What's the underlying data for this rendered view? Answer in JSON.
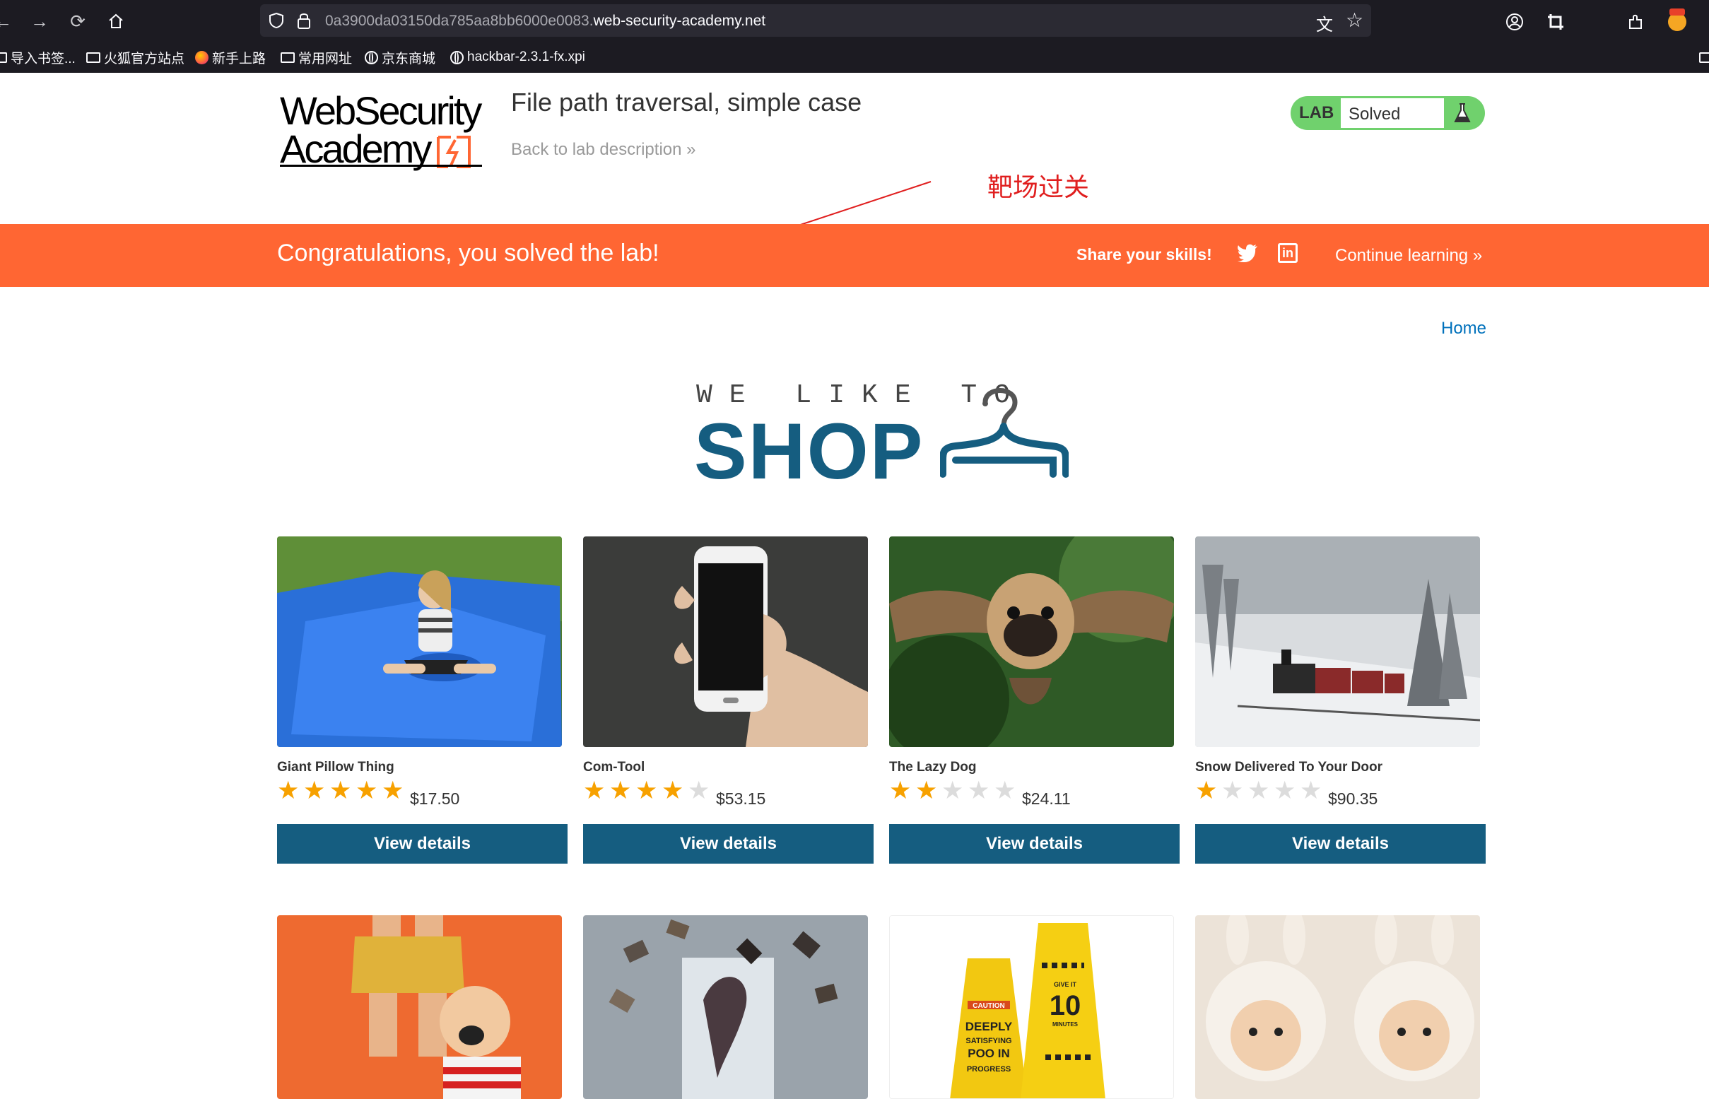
{
  "browser": {
    "url_prefix": "0a3900da03150da785aa8bb6000e0083.",
    "url_domain": "web-security-academy.net",
    "bookmarks": [
      "导入书签...",
      "火狐官方站点",
      "新手上路",
      "常用网址",
      "京东商城",
      "hackbar-2.3.1-fx.xpi"
    ]
  },
  "header": {
    "logo_line1": "WebSecurity",
    "logo_line2": "Academy",
    "lab_title": "File path traversal, simple case",
    "back_link": "Back to lab description",
    "back_chevron": "»",
    "lab_label": "LAB",
    "lab_status": "Solved"
  },
  "annotation": "靶场过关",
  "banner": {
    "message": "Congratulations, you solved the lab!",
    "share": "Share your skills!",
    "continue": "Continue learning",
    "continue_chevron": "»"
  },
  "nav": {
    "home": "Home"
  },
  "hero": {
    "line1": "WE LIKE TO",
    "line2": "SHOP"
  },
  "products": [
    {
      "name": "Giant Pillow Thing",
      "rating": 5,
      "price": "$17.50",
      "button": "View details"
    },
    {
      "name": "Com-Tool",
      "rating": 4,
      "price": "$53.15",
      "button": "View details"
    },
    {
      "name": "The Lazy Dog",
      "rating": 2,
      "price": "$24.11",
      "button": "View details"
    },
    {
      "name": "Snow Delivered To Your Door",
      "rating": 1,
      "price": "$90.35",
      "button": "View details"
    }
  ],
  "sign_text": [
    "CAUTION",
    "DEEPLY",
    "SATISFYING",
    "POO IN",
    "PROGRESS",
    "GIVE IT",
    "10",
    "MINUTES"
  ],
  "colors": {
    "banner": "#ff6633",
    "brand": "#155d80",
    "lab_green": "#70d16d",
    "star_on": "#f7a100",
    "star_off": "#dcdcdc",
    "link": "#0071bc"
  }
}
